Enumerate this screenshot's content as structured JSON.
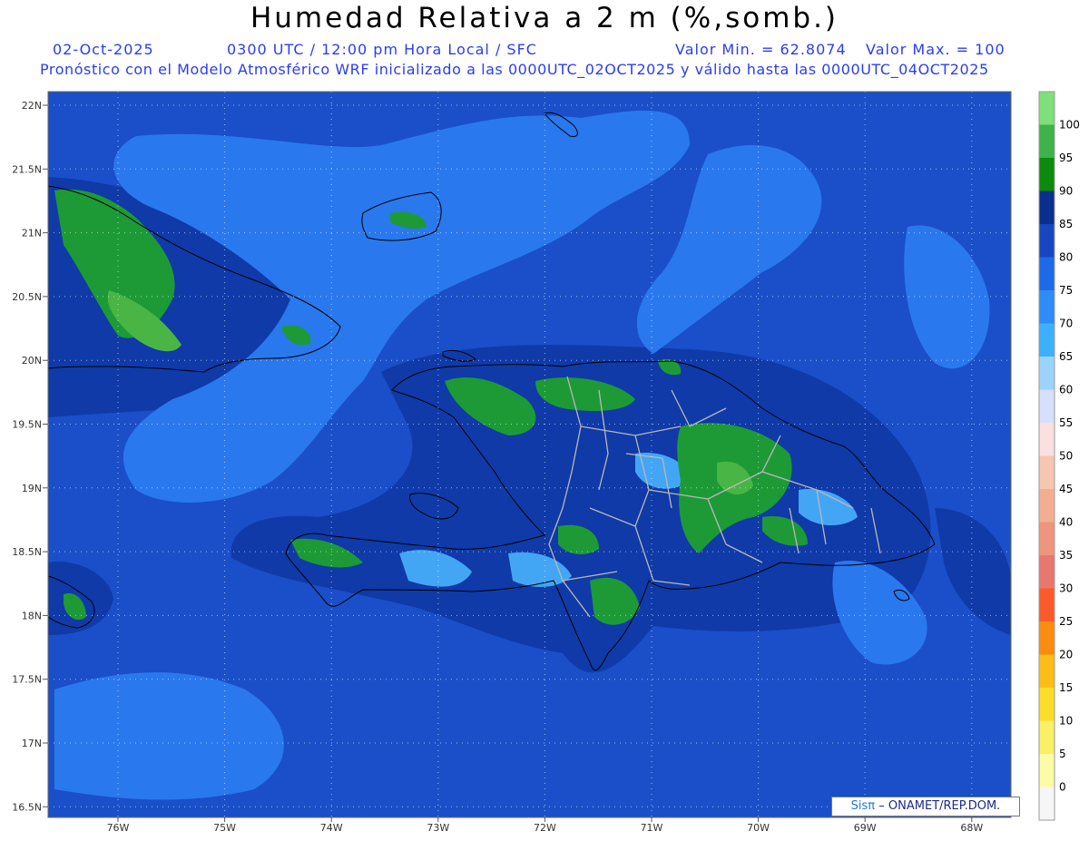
{
  "header": {
    "title": "Humedad Relativa a 2 m (%,somb.)",
    "date": "02-Oct-2025",
    "time_info": "0300 UTC / 12:00 pm Hora Local / SFC",
    "min_value": "Valor Min. = 62.8074",
    "max_value": "Valor Max. = 100",
    "forecast_info": "Pronóstico con el Modelo Atmosférico WRF inicializado a las 0000UTC_02OCT2025 y válido hasta las  0000UTC_04OCT2025"
  },
  "map": {
    "lat_labels": [
      "22N",
      "21.5N",
      "21N",
      "20.5N",
      "20N",
      "19.5N",
      "19N",
      "18.5N",
      "18N",
      "17.5N",
      "17N",
      "16.5N"
    ],
    "lon_labels": [
      "76W",
      "75W",
      "74W",
      "73W",
      "72W",
      "71W",
      "70W",
      "69W",
      "68W"
    ],
    "colors": {
      "ocean_base": "#1a4fc9",
      "dark_band": "#0f3aa8",
      "light_band": "#2a78ee",
      "cyan_band": "#43a6f5",
      "green_high": "#1d9a36",
      "green_mid": "#49b545",
      "boundary": "#000000",
      "province_border": "#b8b8b8"
    }
  },
  "colorbar": {
    "levels": [
      "100",
      "95",
      "90",
      "85",
      "80",
      "75",
      "70",
      "65",
      "60",
      "55",
      "50",
      "45",
      "40",
      "35",
      "30",
      "25",
      "20",
      "15",
      "10",
      "5",
      "0"
    ],
    "colors": [
      "#7ee07a",
      "#3fb24a",
      "#0c8a0c",
      "#0a2e8c",
      "#1846c0",
      "#1e6ae6",
      "#2f8bf6",
      "#3eb0fb",
      "#9dd2fb",
      "#d6e0fb",
      "#fbe0e0",
      "#f6c6b0",
      "#f3ae92",
      "#ef957e",
      "#e8786e",
      "#fb5a2a",
      "#fb8c12",
      "#fbbd18",
      "#fbdd2a",
      "#f8f065",
      "#fcfca6",
      "#f6f6f6"
    ]
  },
  "credit": {
    "logo": "Sisπ",
    "text": "– ONAMET/REP.DOM."
  }
}
